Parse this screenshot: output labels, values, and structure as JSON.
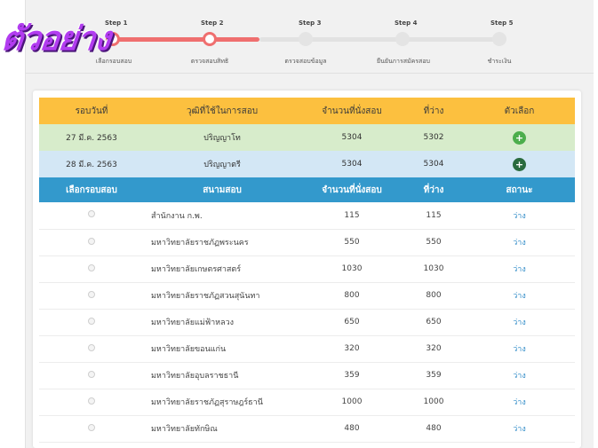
{
  "watermark": "ตัวอย่าง",
  "steps": [
    {
      "num": "Step 1",
      "label": "เลือกรอบสอบ"
    },
    {
      "num": "Step 2",
      "label": "ตรวจสอบสิทธิ"
    },
    {
      "num": "Step 3",
      "label": "ตรวจสอบข้อมูล"
    },
    {
      "num": "Step 4",
      "label": "ยืนยันการสมัครสอบ"
    },
    {
      "num": "Step 5",
      "label": "ชำระเงิน"
    }
  ],
  "round_table": {
    "headers": [
      "รอบวันที่",
      "วุฒิที่ใช้ในการสอบ",
      "จำนวนที่นั่งสอบ",
      "ที่ว่าง",
      "ตัวเลือก"
    ],
    "rows": [
      {
        "date": "27 มี.ค. 2563",
        "degree": "ปริญญาโท",
        "seats": "5304",
        "available": "5302",
        "action": "+"
      },
      {
        "date": "28 มี.ค. 2563",
        "degree": "ปริญญาตรี",
        "seats": "5304",
        "available": "5304",
        "action": "+"
      }
    ]
  },
  "site_table": {
    "headers": [
      "เลือกรอบสอบ",
      "สนามสอบ",
      "จำนวนที่นั่งสอบ",
      "ที่ว่าง",
      "สถานะ"
    ],
    "rows": [
      {
        "name": "สำนักงาน ก.พ.",
        "seats": "115",
        "available": "115",
        "status": "ว่าง"
      },
      {
        "name": "มหาวิทยาลัยราชภัฏพระนคร",
        "seats": "550",
        "available": "550",
        "status": "ว่าง"
      },
      {
        "name": "มหาวิทยาลัยเกษตรศาสตร์",
        "seats": "1030",
        "available": "1030",
        "status": "ว่าง"
      },
      {
        "name": "มหาวิทยาลัยราชภัฏสวนสุนันทา",
        "seats": "800",
        "available": "800",
        "status": "ว่าง"
      },
      {
        "name": "มหาวิทยาลัยแม่ฟ้าหลวง",
        "seats": "650",
        "available": "650",
        "status": "ว่าง"
      },
      {
        "name": "มหาวิทยาลัยขอนแก่น",
        "seats": "320",
        "available": "320",
        "status": "ว่าง"
      },
      {
        "name": "มหาวิทยาลัยอุบลราชธานี",
        "seats": "359",
        "available": "359",
        "status": "ว่าง"
      },
      {
        "name": "มหาวิทยาลัยราชภัฏสุราษฎร์ธานี",
        "seats": "1000",
        "available": "1000",
        "status": "ว่าง"
      },
      {
        "name": "มหาวิทยาลัยทักษิณ",
        "seats": "480",
        "available": "480",
        "status": "ว่าง"
      }
    ]
  },
  "colors": {
    "step_active": "#ef6f6f",
    "header_yellow": "#fcc03f",
    "header_blue": "#3399cc",
    "row_green": "#d7eccb",
    "row_blue": "#d3e7f5",
    "status_blue": "#2d8ac7"
  }
}
